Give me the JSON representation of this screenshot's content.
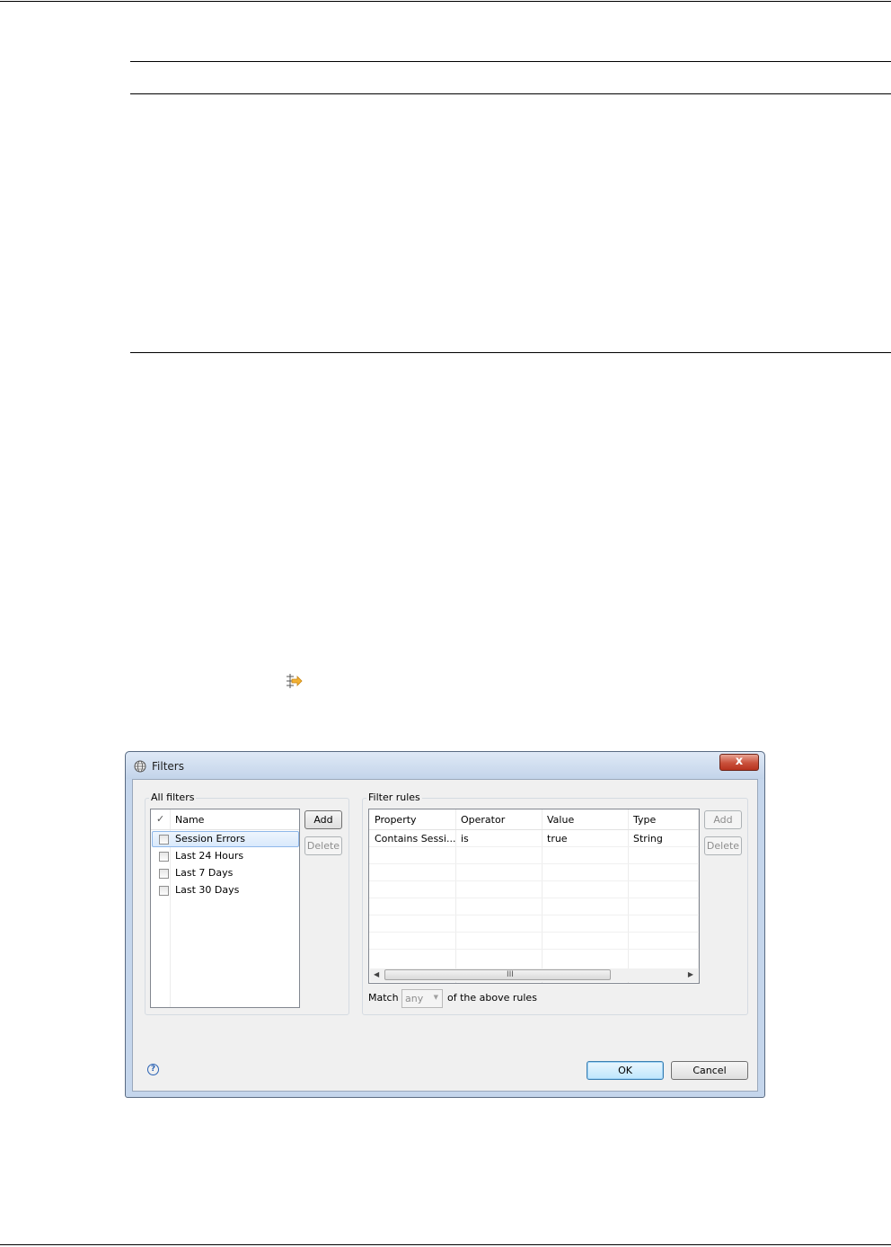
{
  "dialog": {
    "title": "Filters",
    "close_label": "x",
    "all_filters": {
      "group_label": "All filters",
      "header_check": "✓",
      "header_name": "Name",
      "items": [
        {
          "label": "Session Errors",
          "selected": true
        },
        {
          "label": "Last 24 Hours"
        },
        {
          "label": "Last 7 Days"
        },
        {
          "label": "Last 30 Days"
        }
      ],
      "add_label": "Add",
      "delete_label": "Delete"
    },
    "filter_rules": {
      "group_label": "Filter rules",
      "columns": [
        "Property",
        "Operator",
        "Value",
        "Type"
      ],
      "rows": [
        [
          "Contains Sessi...",
          "is",
          "true",
          "String"
        ]
      ],
      "add_label": "Add",
      "delete_label": "Delete",
      "scroll_grip": "III"
    },
    "match": {
      "prefix": "Match",
      "value": "any",
      "suffix": "of the above rules"
    },
    "help_label": "?",
    "ok_label": "OK",
    "cancel_label": "Cancel"
  }
}
